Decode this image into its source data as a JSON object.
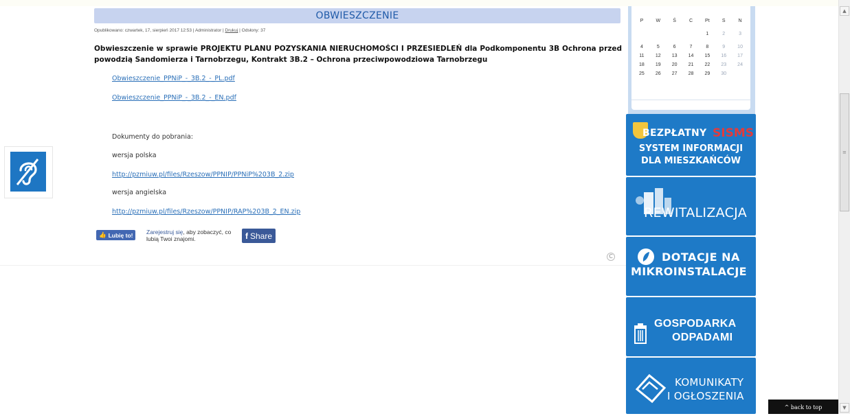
{
  "article": {
    "title": "OBWIESZCZENIE",
    "meta_prefix": "Opublikowano: czwartek, 17, sierpień 2017 12:53 | Administrator | ",
    "meta_print": "Drukuj",
    "meta_suffix": " | Odsłony: 37",
    "heading": "Obwieszczenie w sprawie PROJEKTU PLANU POZYSKANIA NIERUCHOMOŚCI I PRZESIEDLEŃ dla Podkomponentu 3B Ochrona przed powodzią Sandomierza i Tarnobrzegu, Kontrakt 3B.2 – Ochrona przeciwpowodziowa Tarnobrzegu",
    "file_link_pl": "Obwieszczenie_PPNiP_-_3B.2_-_PL.pdf",
    "file_link_en": "Obwieszczenie_PPNiP_-_3B.2_-_EN.pdf",
    "docs_label": "Dokumenty do pobrania:",
    "polish_label": "wersja polska",
    "polish_url": "http://pzmiuw.pl/files/Rzeszow/PPNIP/PPNiP%203B_2.zip",
    "english_label": "wersja angielska",
    "english_url": "http://pzmiuw.pl/files/Rzeszow/PPNIP/RAP%203B_2_EN.zip"
  },
  "facebook": {
    "like_label": "Lubię to!",
    "register_link": "Zarejestruj się",
    "register_rest": ", aby zobaczyć, co lubią Twoi znajomi.",
    "share_label": "Share"
  },
  "calendar": {
    "weekdays": [
      "P",
      "W",
      "Ś",
      "C",
      "Pt",
      "S",
      "N"
    ],
    "weeks": [
      [
        "",
        "",
        "",
        "",
        "1",
        "2",
        "3"
      ],
      [
        "4",
        "5",
        "6",
        "7",
        "8",
        "9",
        "10"
      ],
      [
        "11",
        "12",
        "13",
        "14",
        "15",
        "16",
        "17"
      ],
      [
        "18",
        "19",
        "20",
        "21",
        "22",
        "23",
        "24"
      ],
      [
        "25",
        "26",
        "27",
        "28",
        "29",
        "30",
        ""
      ]
    ]
  },
  "banners": {
    "sms_line1": "BEZPŁATNY",
    "sms_brand": "SISMS",
    "sms_line2": "SYSTEM INFORMACJI",
    "sms_line3": "DLA MIESZKAŃCÓW",
    "rewitalizacja": "REWITALIZACJA",
    "dotacje_line1": "DOTACJE NA",
    "dotacje_line2": "MIKROINSTALACJE",
    "odpady_line1": "GOSPODARKA",
    "odpady_line2": "ODPADAMI",
    "komunikaty_line1": "KOMUNIKATY",
    "komunikaty_line2": "I OGŁOSZENIA"
  },
  "back_to_top": "^ back to top",
  "colors": {
    "banner_blue": "#1e7ac7",
    "title_bar": "#c7d3ef",
    "link_blue": "#2a6fb8",
    "calendar_frame": "#c8dbf1"
  }
}
